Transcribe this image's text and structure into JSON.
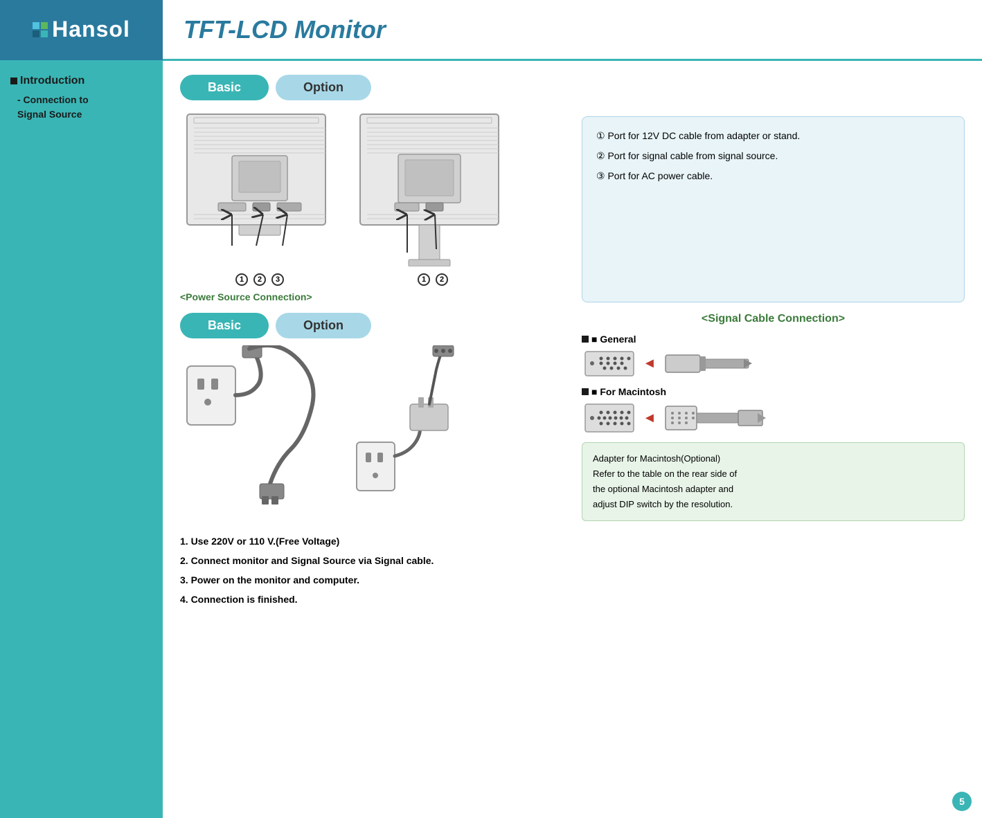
{
  "header": {
    "logo": "Hansol",
    "title": "TFT-LCD Monitor"
  },
  "sidebar": {
    "intro_label": "Introduction",
    "sub_label1": "- Connection to",
    "sub_label2": "Signal Source"
  },
  "top_tabs": {
    "basic_label": "Basic",
    "option_label": "Option"
  },
  "monitor_section": {
    "basic_circles": [
      "①",
      "②",
      "③"
    ],
    "option_circles": [
      "①",
      "②"
    ],
    "power_source_label": "<Power Source Connection>",
    "signal_cable_label": "<Signal Cable Connection>"
  },
  "info_box": {
    "line1": "①  Port for 12V DC cable from adapter or stand.",
    "line2": "②  Port for signal cable from signal source.",
    "line3": "③  Port for AC power cable."
  },
  "signal": {
    "general_label": "■ General",
    "macintosh_label": "■ For Macintosh"
  },
  "adapter_box": {
    "line1": "Adapter for Macintosh(Optional)",
    "line2": "Refer to the table on the rear side of",
    "line3": "the optional Macintosh adapter and",
    "line4": "adjust DIP switch by the resolution."
  },
  "footer": {
    "note1": "1. Use 220V or 110 V.(Free Voltage)",
    "note2": "2. Connect monitor and Signal Source via Signal cable.",
    "note3": "3. Power on the monitor and computer.",
    "note4": "4. Connection is finished."
  },
  "page": {
    "number": "5"
  }
}
